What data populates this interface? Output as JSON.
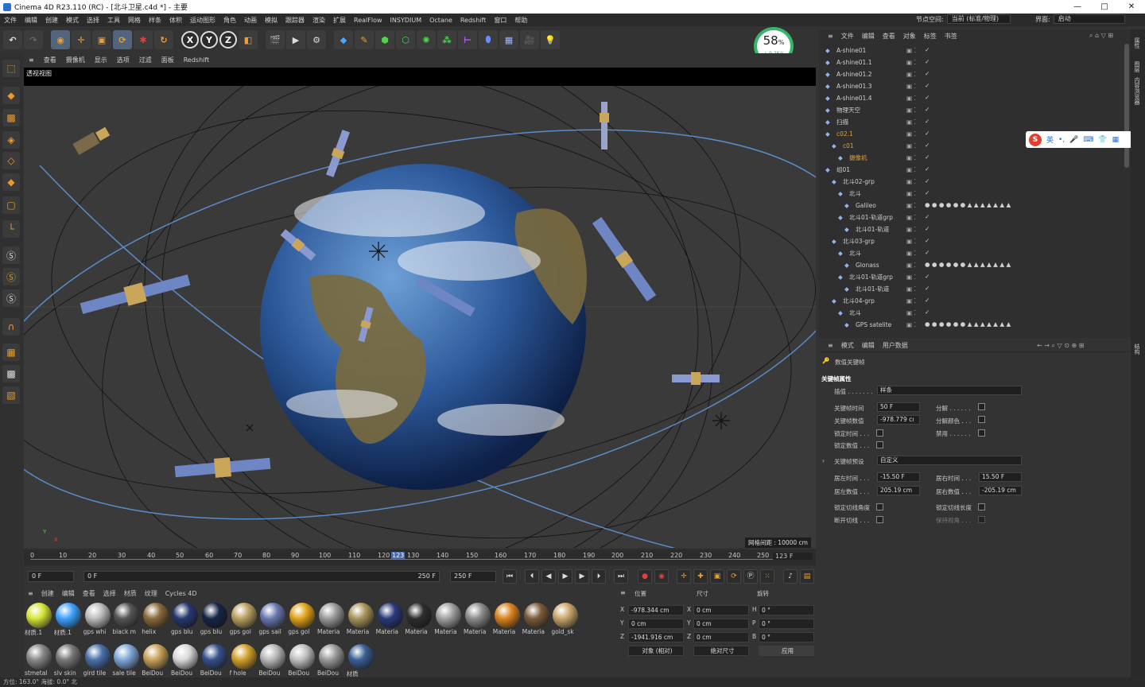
{
  "window": {
    "title": "Cinema 4D R23.110 (RC) - [北斗卫星.c4d *] - 主要",
    "controls": [
      "—",
      "□",
      "✕"
    ]
  },
  "menubar": {
    "items": [
      "文件",
      "编辑",
      "创建",
      "模式",
      "选择",
      "工具",
      "网格",
      "样条",
      "体积",
      "运动图形",
      "角色",
      "动画",
      "模拟",
      "跟踪器",
      "渲染",
      "扩展",
      "RealFlow",
      "INSYDIUM",
      "Octane",
      "Redshift",
      "窗口",
      "帮助"
    ],
    "node_space_label": "节点空间:",
    "node_space_value": "当前 (标准/物理)",
    "layout_label": "界面:",
    "layout_value": "启动"
  },
  "toolbar": {
    "x": "X",
    "y": "Y",
    "z": "Z"
  },
  "speedometer": {
    "percent": "58",
    "unit": "%",
    "rate": "↓ 9.2K/s"
  },
  "viewport": {
    "menu": [
      "查看",
      "摄像机",
      "显示",
      "选项",
      "过滤",
      "面板",
      "Redshift"
    ],
    "view_name": "透视视图",
    "grid_spacing": "网格间距 : 10000 cm"
  },
  "timeline": {
    "ticks": [
      "0",
      "10",
      "20",
      "30",
      "40",
      "50",
      "60",
      "70",
      "80",
      "90",
      "100",
      "110",
      "120",
      "123",
      "130",
      "140",
      "150",
      "160",
      "170",
      "180",
      "190",
      "200",
      "210",
      "220",
      "230",
      "240",
      "250"
    ],
    "current_frame_marker": "123",
    "current_frame_field": "123 F",
    "start_field": "0 F",
    "range_start": "0 F",
    "range_end": "250 F",
    "end_field": "250 F"
  },
  "materials": {
    "menu": [
      "创建",
      "编辑",
      "查看",
      "选择",
      "材质",
      "纹理",
      "Cycles 4D"
    ],
    "items": [
      {
        "name": "材质.1",
        "color": "#d6e53a"
      },
      {
        "name": "材质.1",
        "color": "#3ea2ff"
      },
      {
        "name": "gps whi",
        "color": "#bcbcbc"
      },
      {
        "name": "black m",
        "color": "#555"
      },
      {
        "name": "helix",
        "color": "#8a6a3a"
      },
      {
        "name": "gps blu",
        "color": "#26386e"
      },
      {
        "name": "gps blu",
        "color": "#162546"
      },
      {
        "name": "gps gol",
        "color": "#b9a060"
      },
      {
        "name": "gps sail",
        "color": "#6a78b0"
      },
      {
        "name": "gps gol",
        "color": "#e0a21a"
      },
      {
        "name": "Materia",
        "color": "#9a9a9a"
      },
      {
        "name": "Materia",
        "color": "#a8945a"
      },
      {
        "name": "Materia",
        "color": "#2a3a7a"
      },
      {
        "name": "Materia",
        "color": "#2e2e2e"
      },
      {
        "name": "Materia",
        "color": "#a0a0a0"
      },
      {
        "name": "Materia",
        "color": "#8c8c8c"
      },
      {
        "name": "Materia",
        "color": "#d9821e"
      },
      {
        "name": "Materia",
        "color": "#7a5a3a"
      },
      {
        "name": "gold_sk",
        "color": "#c8a66a"
      },
      {
        "name": "stmetal",
        "color": "#888"
      },
      {
        "name": "slv skin",
        "color": "#777"
      },
      {
        "name": "gird tile",
        "color": "#4a6fa8"
      },
      {
        "name": "sale tile",
        "color": "#7fa7d8"
      },
      {
        "name": "BeiDou",
        "color": "#c7a15a"
      },
      {
        "name": "BeiDou",
        "color": "#d8d8d8"
      },
      {
        "name": "BeiDou",
        "color": "#35508a"
      },
      {
        "name": "f hole",
        "color": "#d0a02a"
      },
      {
        "name": "BeiDou",
        "color": "#b8b8b8"
      },
      {
        "name": "BeiDou",
        "color": "#c0c0c0"
      },
      {
        "name": "BeiDou",
        "color": "#9a9a9a"
      },
      {
        "name": "材质",
        "color": "#3b5f94"
      }
    ]
  },
  "coordinates": {
    "headers": [
      "位置",
      "尺寸",
      "旋转"
    ],
    "rows": [
      {
        "axis": "X",
        "pos": "-978.344 cm",
        "size_axis": "X",
        "size": "0 cm",
        "rot_axis": "H",
        "rot": "0 °"
      },
      {
        "axis": "Y",
        "pos": "0 cm",
        "size_axis": "Y",
        "size": "0 cm",
        "rot_axis": "P",
        "rot": "0 °"
      },
      {
        "axis": "Z",
        "pos": "-1941.916 cm",
        "size_axis": "Z",
        "size": "0 cm",
        "rot_axis": "B",
        "rot": "0 °"
      }
    ],
    "mode": "对象 (相对)",
    "size_mode": "绝对尺寸",
    "apply": "应用"
  },
  "objects": {
    "menu": [
      "文件",
      "编辑",
      "查看",
      "对象",
      "标签",
      "书签"
    ],
    "rows": [
      {
        "name": "A-shine01",
        "indent": 0,
        "color": "#cfcfcf"
      },
      {
        "name": "A-shine01.1",
        "indent": 0,
        "color": "#cfcfcf"
      },
      {
        "name": "A-shine01.2",
        "indent": 0,
        "color": "#cfcfcf"
      },
      {
        "name": "A-shine01.3",
        "indent": 0,
        "color": "#cfcfcf"
      },
      {
        "name": "A-shine01.4",
        "indent": 0,
        "color": "#cfcfcf"
      },
      {
        "name": "物理天空",
        "indent": 0,
        "color": "#cfcfcf"
      },
      {
        "name": "扫描",
        "indent": 0,
        "color": "#cfcfcf"
      },
      {
        "name": "c02.1",
        "indent": 0,
        "color": "#e2a23c"
      },
      {
        "name": "c01",
        "indent": 1,
        "color": "#e2a23c"
      },
      {
        "name": "摄像机",
        "indent": 2,
        "color": "#e2a23c"
      },
      {
        "name": "组01",
        "indent": 0,
        "color": "#cfcfcf"
      },
      {
        "name": "北斗02-grp",
        "indent": 1,
        "color": "#cfcfcf"
      },
      {
        "name": "北斗",
        "indent": 2,
        "color": "#cfcfcf"
      },
      {
        "name": "Galileo",
        "indent": 3,
        "color": "#cfcfcf"
      },
      {
        "name": "北斗01-轨道grp",
        "indent": 2,
        "color": "#cfcfcf"
      },
      {
        "name": "北斗01-轨道",
        "indent": 3,
        "color": "#cfcfcf"
      },
      {
        "name": "北斗03-grp",
        "indent": 1,
        "color": "#cfcfcf"
      },
      {
        "name": "北斗",
        "indent": 2,
        "color": "#cfcfcf"
      },
      {
        "name": "Glonass",
        "indent": 3,
        "color": "#cfcfcf"
      },
      {
        "name": "北斗01-轨道grp",
        "indent": 2,
        "color": "#cfcfcf"
      },
      {
        "name": "北斗01-轨道",
        "indent": 3,
        "color": "#cfcfcf"
      },
      {
        "name": "北斗04-grp",
        "indent": 1,
        "color": "#cfcfcf"
      },
      {
        "name": "北斗",
        "indent": 2,
        "color": "#cfcfcf"
      },
      {
        "name": "GPS satelite",
        "indent": 3,
        "color": "#cfcfcf"
      }
    ]
  },
  "attributes": {
    "menu": [
      "模式",
      "编辑",
      "用户数据"
    ],
    "header": "数值关键帧",
    "section": "关键帧属性",
    "interp_label": "插值 . . . . . . .",
    "interp_value": "样条",
    "key_time_label": "关键帧时间",
    "key_time_value": "50 F",
    "key_value_label": "关键帧数值",
    "key_value_value": "-978.779 cı",
    "lock_time_label": "锁定时间 . . .",
    "lock_value_label": "锁定数值 . . .",
    "break_label": "分解 . . . . . .",
    "break_color_label": "分解颜色 . . .",
    "mute_label": "禁用 . . . . . .",
    "preset_label": "关键帧预设",
    "preset_value": "自定义",
    "left_time_label": "居左时间 . . .",
    "left_time_value": "-15.50 F",
    "right_time_label": "居右时间 . . .",
    "right_time_value": "15.50 F",
    "left_value_label": "居左数值 . . .",
    "left_value_value": "205.19 cm",
    "right_value_label": "居右数值 . . .",
    "right_value_value": "-205.19 cm",
    "lock_tan_angle_label": "锁定切线角度",
    "lock_tan_len_label": "锁定切线长度",
    "break_tan_label": "断开切线 . . .",
    "keep_angle_label": "保持视角 . . ."
  },
  "right_strip": [
    "属性",
    "图层",
    "内容浏览器",
    "结构"
  ],
  "ime": {
    "lang": "英"
  },
  "status": {
    "text": "方位: 163.0°  海拔: 0.0°  北"
  }
}
